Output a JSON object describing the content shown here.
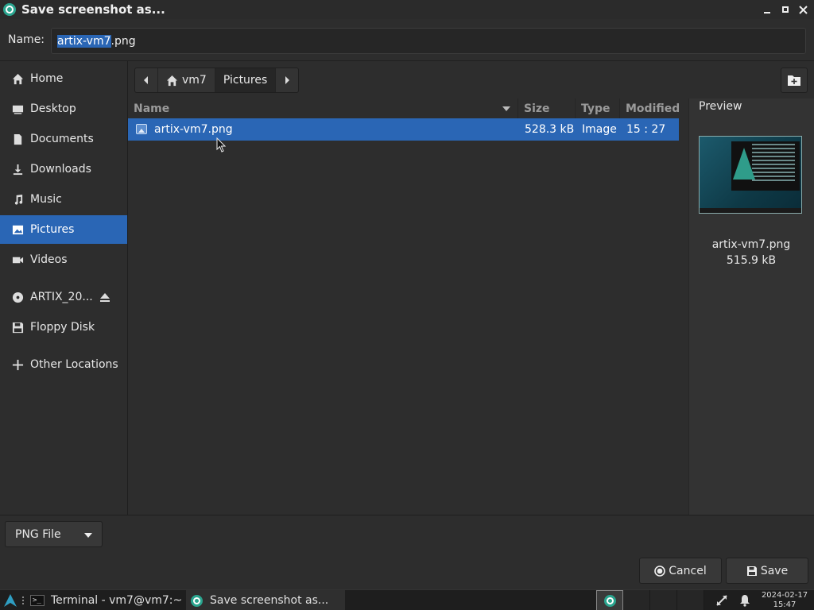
{
  "window": {
    "title": "Save screenshot as...",
    "buttons": {
      "minimize": "minimize",
      "maximize": "maximize",
      "close": "close"
    }
  },
  "name_field": {
    "label": "Name:",
    "value_selected": "artix-vm7",
    "value_rest": ".png"
  },
  "sidebar": {
    "items": [
      {
        "label": "Home",
        "icon": "home-icon"
      },
      {
        "label": "Desktop",
        "icon": "desktop-icon"
      },
      {
        "label": "Documents",
        "icon": "document-icon"
      },
      {
        "label": "Downloads",
        "icon": "download-icon"
      },
      {
        "label": "Music",
        "icon": "music-icon"
      },
      {
        "label": "Pictures",
        "icon": "picture-icon",
        "active": true
      },
      {
        "label": "Videos",
        "icon": "video-icon"
      },
      {
        "label": "ARTIX_20...",
        "icon": "disc-icon"
      },
      {
        "label": "Floppy Disk",
        "icon": "floppy-icon"
      },
      {
        "label": "Other Locations",
        "icon": "plus-icon"
      }
    ]
  },
  "pathbar": {
    "segments": [
      "vm7",
      "Pictures"
    ]
  },
  "filelist": {
    "columns": [
      "Name",
      "Size",
      "Type",
      "Modified"
    ],
    "rows": [
      {
        "name": "artix-vm7.png",
        "size": "528.3 kB",
        "type": "Image",
        "modified": "15 : 27"
      }
    ]
  },
  "preview": {
    "label": "Preview",
    "file_name": "artix-vm7.png",
    "file_size": "515.9 kB"
  },
  "filter": {
    "selected": "PNG File"
  },
  "actions": {
    "cancel": "Cancel",
    "save": "Save"
  },
  "taskbar": {
    "tasks": [
      "Terminal - vm7@vm7:~",
      "Save screenshot as..."
    ],
    "clock_date": "2024-02-17",
    "clock_time": "15:47"
  },
  "colors": {
    "accent": "#2a66b5",
    "app_icon": "#2aa58f",
    "background": "#2d2d2d"
  }
}
